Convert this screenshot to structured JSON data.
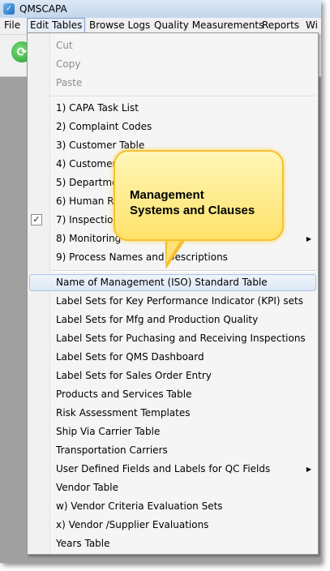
{
  "window": {
    "title": "QMSCAPA"
  },
  "menubar": {
    "items": [
      "File",
      "Edit Tables",
      "Browse Logs",
      "Quality Measurements",
      "Reports",
      "Wi"
    ]
  },
  "dropdown": {
    "edit_items": [
      "Cut",
      "Copy",
      "Paste"
    ],
    "numbered_items": [
      "1) CAPA Task List",
      "2) Complaint Codes",
      "3) Customer Table",
      "4) Customer Su",
      "5) Departmen",
      "6) Human Res",
      "7) Inspection (",
      "8) Monitoring",
      "9) Process Names and Descriptions"
    ],
    "table_items": [
      "Name of Management (ISO) Standard Table",
      "Label Sets for Key Performance Indicator (KPI) sets",
      "Label Sets for Mfg and Production Quality",
      "Label Sets for Puchasing and Receiving Inspections",
      "Label Sets for QMS Dashboard",
      "Label Sets for Sales Order Entry",
      "Products and Services Table",
      "Risk Assessment Templates",
      "Ship Via Carrier Table",
      "Transportation Carriers",
      "User Defined Fields and Labels for QC Fields",
      "Vendor Table",
      "w) Vendor Criteria Evaluation Sets",
      "x) Vendor /Supplier Evaluations",
      "Years Table"
    ]
  },
  "callout": {
    "line1": "Management",
    "line2": "Systems and Clauses"
  },
  "icons": {
    "app": "app-icon",
    "toolbar": "green-refresh-icon",
    "check": "checkmark-icon",
    "submenu": "submenu-arrow-icon"
  },
  "colors": {
    "callout_fill": "#ffe26a",
    "callout_border": "#f4c030",
    "highlight": "#dde8f5",
    "workspace": "#a0a0a0"
  }
}
